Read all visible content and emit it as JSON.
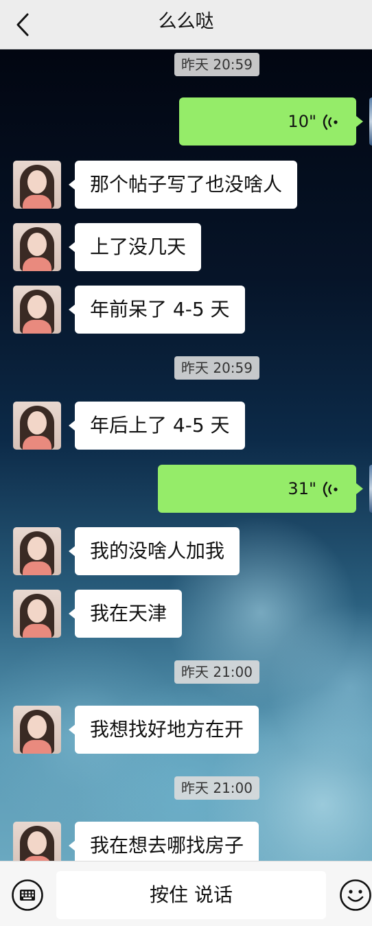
{
  "header": {
    "title": "么么哒",
    "back_icon": "chevron-left-icon"
  },
  "messages": [
    {
      "type": "timestamp",
      "text": "昨天 20:59"
    },
    {
      "type": "voice",
      "side": "right",
      "duration": "10\""
    },
    {
      "type": "text",
      "side": "left",
      "text": "那个帖子写了也没啥人"
    },
    {
      "type": "text",
      "side": "left",
      "text": "上了没几天"
    },
    {
      "type": "text",
      "side": "left",
      "text": "年前呆了 4-5 天"
    },
    {
      "type": "timestamp",
      "text": "昨天 20:59"
    },
    {
      "type": "text",
      "side": "left",
      "text": "年后上了 4-5 天"
    },
    {
      "type": "voice",
      "side": "right",
      "duration": "31\""
    },
    {
      "type": "text",
      "side": "left",
      "text": "我的没啥人加我"
    },
    {
      "type": "text",
      "side": "left",
      "text": "我在天津"
    },
    {
      "type": "timestamp",
      "text": "昨天 21:00"
    },
    {
      "type": "text",
      "side": "left",
      "text": "我想找好地方在开"
    },
    {
      "type": "timestamp",
      "text": "昨天 21:00"
    },
    {
      "type": "text",
      "side": "left",
      "text": "我在想去哪找房子"
    }
  ],
  "input_bar": {
    "talk_label": "按住 说话",
    "keyboard_icon": "keyboard-icon",
    "emoji_icon": "emoji-icon"
  },
  "colors": {
    "header_bg": "#ededed",
    "voice_bubble": "#95ec69",
    "text_bubble": "#ffffff"
  }
}
